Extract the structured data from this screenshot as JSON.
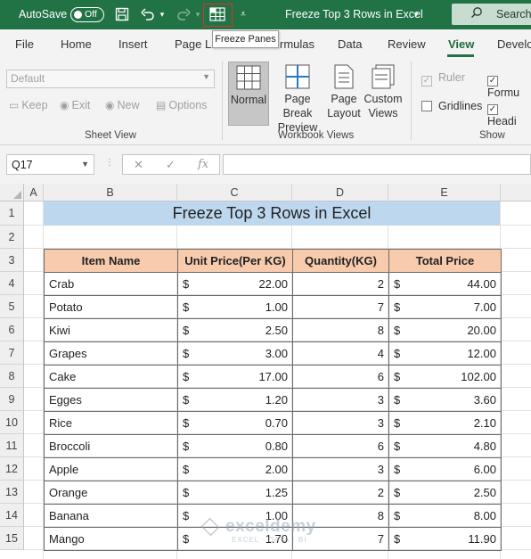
{
  "titlebar": {
    "autosave_label": "AutoSave",
    "autosave_state": "Off",
    "doc_title": "Freeze Top 3 Rows in Excel",
    "search_label": "Search",
    "bg_color": "#217346"
  },
  "tooltip": {
    "text": "Freeze Panes"
  },
  "menu": {
    "tabs": [
      "File",
      "Home",
      "Insert",
      "Page La",
      "rmulas",
      "Data",
      "Review",
      "View",
      "Develo"
    ],
    "active": "View"
  },
  "ribbon": {
    "sheet_view": {
      "combo_value": "Default",
      "keep": "Keep",
      "exit": "Exit",
      "new": "New",
      "options": "Options",
      "label": "Sheet View"
    },
    "workbook_views": {
      "normal": "Normal",
      "page_break_line1": "Page Break",
      "page_break_line2": "Preview",
      "page_layout_line1": "Page",
      "page_layout_line2": "Layout",
      "custom_line1": "Custom",
      "custom_line2": "Views",
      "label": "Workbook Views"
    },
    "show": {
      "ruler": "Ruler",
      "gridlines": "Gridlines",
      "formula": "Formu",
      "headings": "Headi",
      "label": "Show"
    }
  },
  "formula_bar": {
    "name_box": "Q17",
    "cancel": "✕",
    "enter": "✓",
    "fx": "fx",
    "value": ""
  },
  "grid": {
    "columns": [
      "A",
      "B",
      "C",
      "D",
      "E"
    ],
    "rows": [
      "1",
      "2",
      "3",
      "4",
      "5",
      "6",
      "7",
      "8",
      "9",
      "10",
      "11",
      "12",
      "13",
      "14",
      "15"
    ],
    "title": "Freeze Top 3 Rows in Excel",
    "headers": [
      "Item Name",
      "Unit Price(Per KG)",
      "Quantity(KG)",
      "Total Price"
    ],
    "currency": "$",
    "data": [
      [
        "Crab",
        "22.00",
        "2",
        "44.00"
      ],
      [
        "Potato",
        "1.00",
        "7",
        "7.00"
      ],
      [
        "Kiwi",
        "2.50",
        "8",
        "20.00"
      ],
      [
        "Grapes",
        "3.00",
        "4",
        "12.00"
      ],
      [
        "Cake",
        "17.00",
        "6",
        "102.00"
      ],
      [
        "Egges",
        "1.20",
        "3",
        "3.60"
      ],
      [
        "Rice",
        "0.70",
        "3",
        "2.10"
      ],
      [
        "Broccoli",
        "0.80",
        "6",
        "4.80"
      ],
      [
        "Apple",
        "2.00",
        "3",
        "6.00"
      ],
      [
        "Orange",
        "1.25",
        "2",
        "2.50"
      ],
      [
        "Banana",
        "1.00",
        "8",
        "8.00"
      ],
      [
        "Mango",
        "1.70",
        "7",
        "11.90"
      ]
    ],
    "header_color": "#f8cbad",
    "title_color": "#bdd7ee"
  },
  "watermark": {
    "name": "exceldemy",
    "tagline": "EXCEL · DATA · BI"
  }
}
